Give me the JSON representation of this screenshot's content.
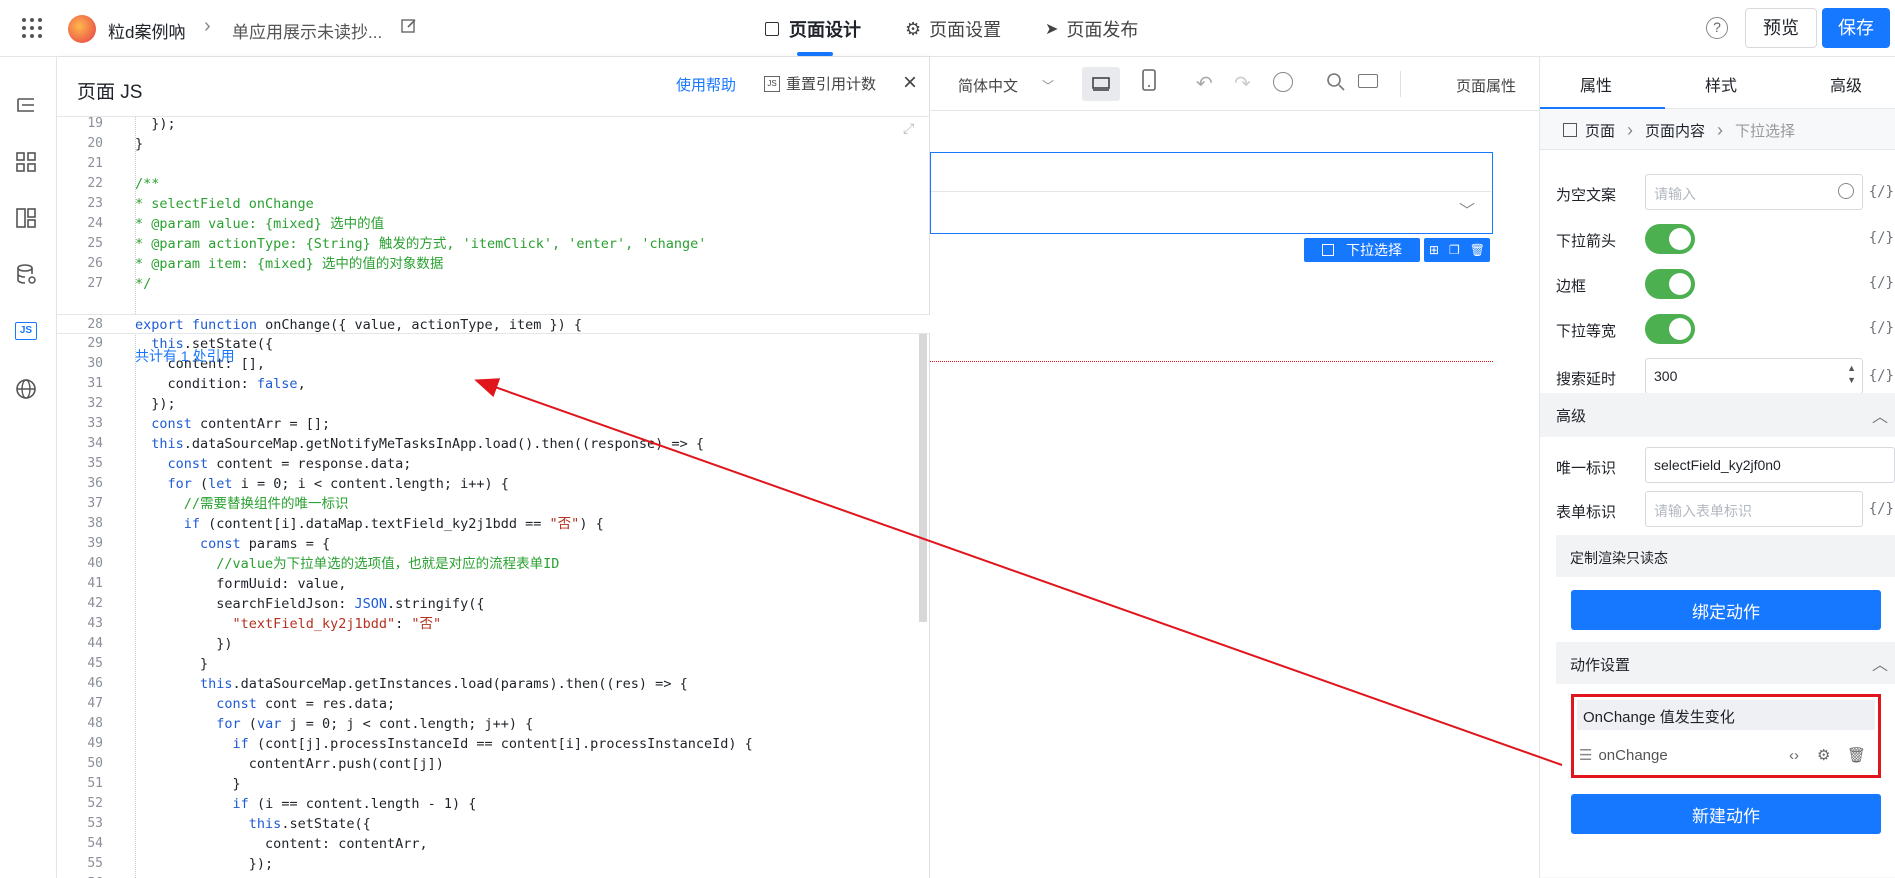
{
  "topbar": {
    "app_name": "粒d案例吶",
    "page_name": "单应用展示未读抄...",
    "tabs": [
      "页面设计",
      "页面设置",
      "页面发布"
    ],
    "preview": "预览",
    "save": "保存",
    "help_icon": "?"
  },
  "js_panel": {
    "title": "页面 JS",
    "help_link": "使用帮助",
    "reset_label": "重置引用计数",
    "ref_count": "共计有 1 处引用"
  },
  "code_lines": [
    {
      "n": "19",
      "t": "  });"
    },
    {
      "n": "20",
      "t": "}"
    },
    {
      "n": "21",
      "t": ""
    },
    {
      "n": "22",
      "t": "/**"
    },
    {
      "n": "23",
      "t": "* selectField onChange"
    },
    {
      "n": "24",
      "t": "* @param value: {mixed} 选中的值"
    },
    {
      "n": "25",
      "t": "* @param actionType: {String} 触发的方式, 'itemClick', 'enter', 'change'"
    },
    {
      "n": "26",
      "t": "* @param item: {mixed} 选中的值的对象数据"
    },
    {
      "n": "27",
      "t": "*/"
    },
    {
      "n": "28",
      "t": "export function onChange({ value, actionType, item }) {"
    },
    {
      "n": "29",
      "t": "  this.setState({"
    },
    {
      "n": "30",
      "t": "    content: [],"
    },
    {
      "n": "31",
      "t": "    condition: false,"
    },
    {
      "n": "32",
      "t": "  });"
    },
    {
      "n": "33",
      "t": "  const contentArr = [];"
    },
    {
      "n": "34",
      "t": "  this.dataSourceMap.getNotifyMeTasksInApp.load().then((response) => {"
    },
    {
      "n": "35",
      "t": "    const content = response.data;"
    },
    {
      "n": "36",
      "t": "    for (let i = 0; i < content.length; i++) {"
    },
    {
      "n": "37",
      "t": "      //需要替换组件的唯一标识"
    },
    {
      "n": "38",
      "t": "      if (content[i].dataMap.textField_ky2j1bdd == \"否\") {"
    },
    {
      "n": "39",
      "t": "        const params = {"
    },
    {
      "n": "40",
      "t": "          //value为下拉单选的选项值，也就是对应的流程表单ID"
    },
    {
      "n": "41",
      "t": "          formUuid: value,"
    },
    {
      "n": "42",
      "t": "          searchFieldJson: JSON.stringify({"
    },
    {
      "n": "43",
      "t": "            \"textField_ky2j1bdd\": \"否\""
    },
    {
      "n": "44",
      "t": "          })"
    },
    {
      "n": "45",
      "t": "        }"
    },
    {
      "n": "46",
      "t": "        this.dataSourceMap.getInstances.load(params).then((res) => {"
    },
    {
      "n": "47",
      "t": "          const cont = res.data;"
    },
    {
      "n": "48",
      "t": "          for (var j = 0; j < cont.length; j++) {"
    },
    {
      "n": "49",
      "t": "            if (cont[j].processInstanceId == content[i].processInstanceId) {"
    },
    {
      "n": "50",
      "t": "              contentArr.push(cont[j])"
    },
    {
      "n": "51",
      "t": "            }"
    },
    {
      "n": "52",
      "t": "            if (i == content.length - 1) {"
    },
    {
      "n": "53",
      "t": "              this.setState({"
    },
    {
      "n": "54",
      "t": "                content: contentArr,"
    },
    {
      "n": "55",
      "t": "              });"
    },
    {
      "n": "56",
      "t": "            }"
    }
  ],
  "canvas": {
    "language": "简体中文",
    "page_props": "页面属性",
    "component_tag": "下拉选择"
  },
  "right_panel": {
    "tabs": [
      "属性",
      "样式",
      "高级"
    ],
    "breadcrumb": [
      "页面",
      "页面内容",
      "下拉选择"
    ],
    "empty_text_label": "为空文案",
    "empty_text_placeholder": "请输入",
    "arrow_label": "下拉箭头",
    "border_label": "边框",
    "equal_width_label": "下拉等宽",
    "search_delay_label": "搜索延时",
    "search_delay_value": "300",
    "advanced_title": "高级",
    "unique_id_label": "唯一标识",
    "unique_id_value": "selectField_ky2jf0n0",
    "form_id_label": "表单标识",
    "form_id_placeholder": "请输入表单标识",
    "custom_readonly": "定制渲染只读态",
    "bind_action": "绑定动作",
    "action_settings": "动作设置",
    "onchange_title": "OnChange 值发生变化",
    "onchange_fn": "onChange",
    "new_action": "新建动作",
    "fx": "{/}"
  },
  "colors": {
    "accent": "#1677ff",
    "annotation": "#e0161c",
    "toggle_on": "#4caf50"
  }
}
